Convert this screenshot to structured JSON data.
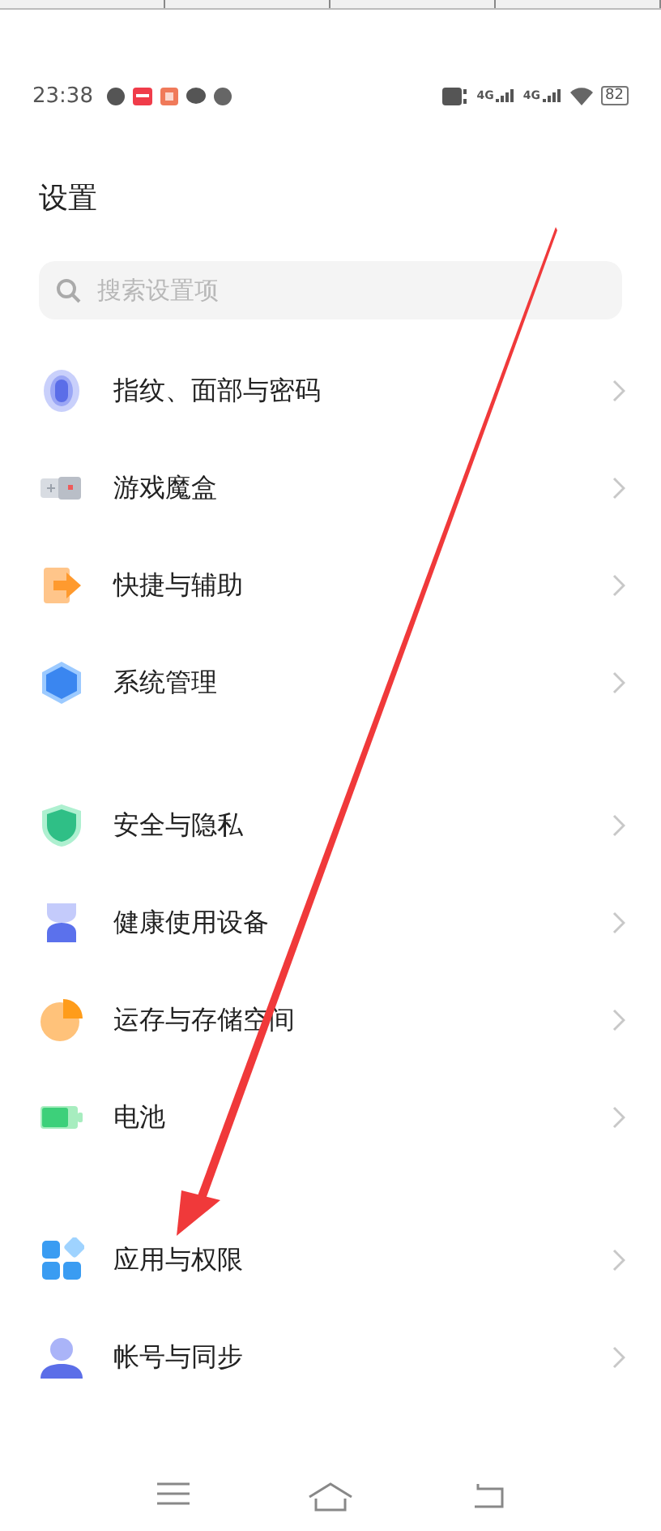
{
  "status_bar": {
    "time": "23:38",
    "network": [
      "4G",
      "4G"
    ],
    "battery": "82"
  },
  "title": "设置",
  "search": {
    "placeholder": "搜索设置项"
  },
  "groups": [
    {
      "items": [
        {
          "label": "指纹、面部与密码"
        },
        {
          "label": "游戏魔盒"
        },
        {
          "label": "快捷与辅助"
        },
        {
          "label": "系统管理"
        }
      ]
    },
    {
      "items": [
        {
          "label": "安全与隐私"
        },
        {
          "label": "健康使用设备"
        },
        {
          "label": "运存与存储空间"
        },
        {
          "label": "电池"
        }
      ]
    },
    {
      "items": [
        {
          "label": "应用与权限"
        },
        {
          "label": "帐号与同步"
        }
      ]
    }
  ]
}
